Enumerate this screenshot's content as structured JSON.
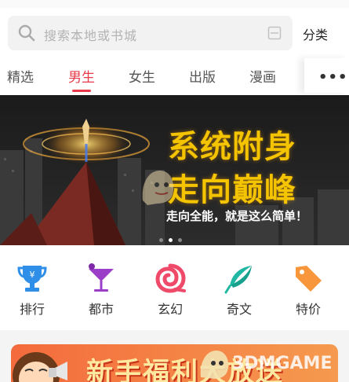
{
  "search": {
    "placeholder": "搜索本地或书城"
  },
  "header": {
    "category_label": "分类"
  },
  "tabs": [
    {
      "label": "精选"
    },
    {
      "label": "男生"
    },
    {
      "label": "女生"
    },
    {
      "label": "出版"
    },
    {
      "label": "漫画"
    }
  ],
  "active_tab": "男生",
  "more_label": "•••",
  "banner": {
    "headline_line1": "系统附身",
    "headline_line2": "走向巅峰",
    "slogan": "走向全能，就是这么简单！",
    "slide_count": 3,
    "active_slide": 2
  },
  "quick_nav": [
    {
      "label": "排行",
      "icon": "trophy-icon",
      "color": "#2f8fe8"
    },
    {
      "label": "都市",
      "icon": "cocktail-icon",
      "color": "#9b3fc8"
    },
    {
      "label": "玄幻",
      "icon": "swirl-icon",
      "color": "#f04a6a"
    },
    {
      "label": "奇文",
      "icon": "quill-icon",
      "color": "#21b8a3"
    },
    {
      "label": "特价",
      "icon": "price-tag-icon",
      "color": "#f7963a"
    }
  ],
  "promo": {
    "text": "新手福利大放送"
  },
  "watermark": {
    "text": "3DMGAME"
  },
  "colors": {
    "accent": "#e8394a",
    "banner_gold": "#f5c400"
  }
}
